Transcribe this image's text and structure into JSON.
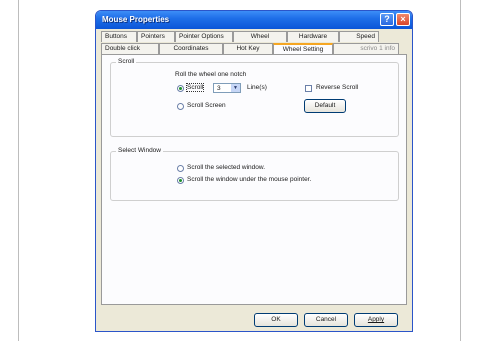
{
  "window": {
    "title": "Mouse Properties"
  },
  "tabs_back": [
    {
      "label": "Buttons"
    },
    {
      "label": "Pointers"
    },
    {
      "label": "Pointer Options"
    },
    {
      "label": "Wheel"
    },
    {
      "label": "Hardware"
    },
    {
      "label": "Speed"
    }
  ],
  "tabs_front": [
    {
      "label": "Double click"
    },
    {
      "label": "Coordinates"
    },
    {
      "label": "Hot Key"
    },
    {
      "label": "Wheel Setting",
      "active": true
    },
    {
      "label": "scrivo 1 info",
      "disabled": true
    }
  ],
  "scroll_group": {
    "label": "Scroll",
    "prompt": "Roll the wheel one notch",
    "scroll_radio_label": "Scroll",
    "lines_value": "3",
    "lines_unit": "Line(s)",
    "reverse_label": "Reverse Scroll",
    "scroll_screen_label": "Scroll Screen",
    "default_label": "Default"
  },
  "select_group": {
    "label": "Select Window",
    "option1": "Scroll the selected window.",
    "option2": "Scroll the window under the mouse pointer."
  },
  "footer": {
    "ok": "OK",
    "cancel": "Cancel",
    "apply": "Apply"
  }
}
